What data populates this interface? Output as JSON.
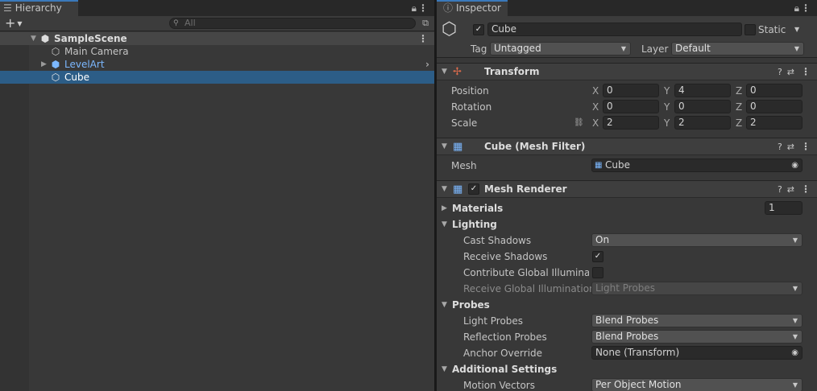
{
  "hierarchy": {
    "tab_label": "Hierarchy",
    "add_label": "+",
    "search_placeholder": "All",
    "scene": "SampleScene",
    "items": [
      {
        "label": "Main Camera"
      },
      {
        "label": "LevelArt"
      },
      {
        "label": "Cube"
      }
    ]
  },
  "inspector": {
    "tab_label": "Inspector",
    "object_name": "Cube",
    "static_label": "Static",
    "tag_label": "Tag",
    "tag_value": "Untagged",
    "layer_label": "Layer",
    "layer_value": "Default",
    "transform": {
      "title": "Transform",
      "position_label": "Position",
      "rotation_label": "Rotation",
      "scale_label": "Scale",
      "axis_x": "X",
      "axis_y": "Y",
      "axis_z": "Z",
      "position": [
        "0",
        "4",
        "0"
      ],
      "rotation": [
        "0",
        "0",
        "0"
      ],
      "scale": [
        "2",
        "2",
        "2"
      ]
    },
    "mesh_filter": {
      "title": "Cube (Mesh Filter)",
      "mesh_label": "Mesh",
      "mesh_value": "Cube"
    },
    "mesh_renderer": {
      "title": "Mesh Renderer",
      "materials_label": "Materials",
      "materials_count": "1",
      "lighting_label": "Lighting",
      "cast_shadows_label": "Cast Shadows",
      "cast_shadows_value": "On",
      "receive_shadows_label": "Receive Shadows",
      "contribute_gi_label": "Contribute Global Illuminatio",
      "receive_gi_label": "Receive Global Illumination",
      "receive_gi_value": "Light Probes",
      "probes_label": "Probes",
      "light_probes_label": "Light Probes",
      "light_probes_value": "Blend Probes",
      "reflection_probes_label": "Reflection Probes",
      "reflection_probes_value": "Blend Probes",
      "anchor_override_label": "Anchor Override",
      "anchor_override_value": "None (Transform)",
      "additional_settings_label": "Additional Settings",
      "motion_vectors_label": "Motion Vectors",
      "motion_vectors_value": "Per Object Motion"
    }
  },
  "colors": {
    "selection": "#2c5d87",
    "panel": "#383838",
    "tab_accent": "#3a79bb",
    "prefab_blue": "#7cb8ff"
  }
}
